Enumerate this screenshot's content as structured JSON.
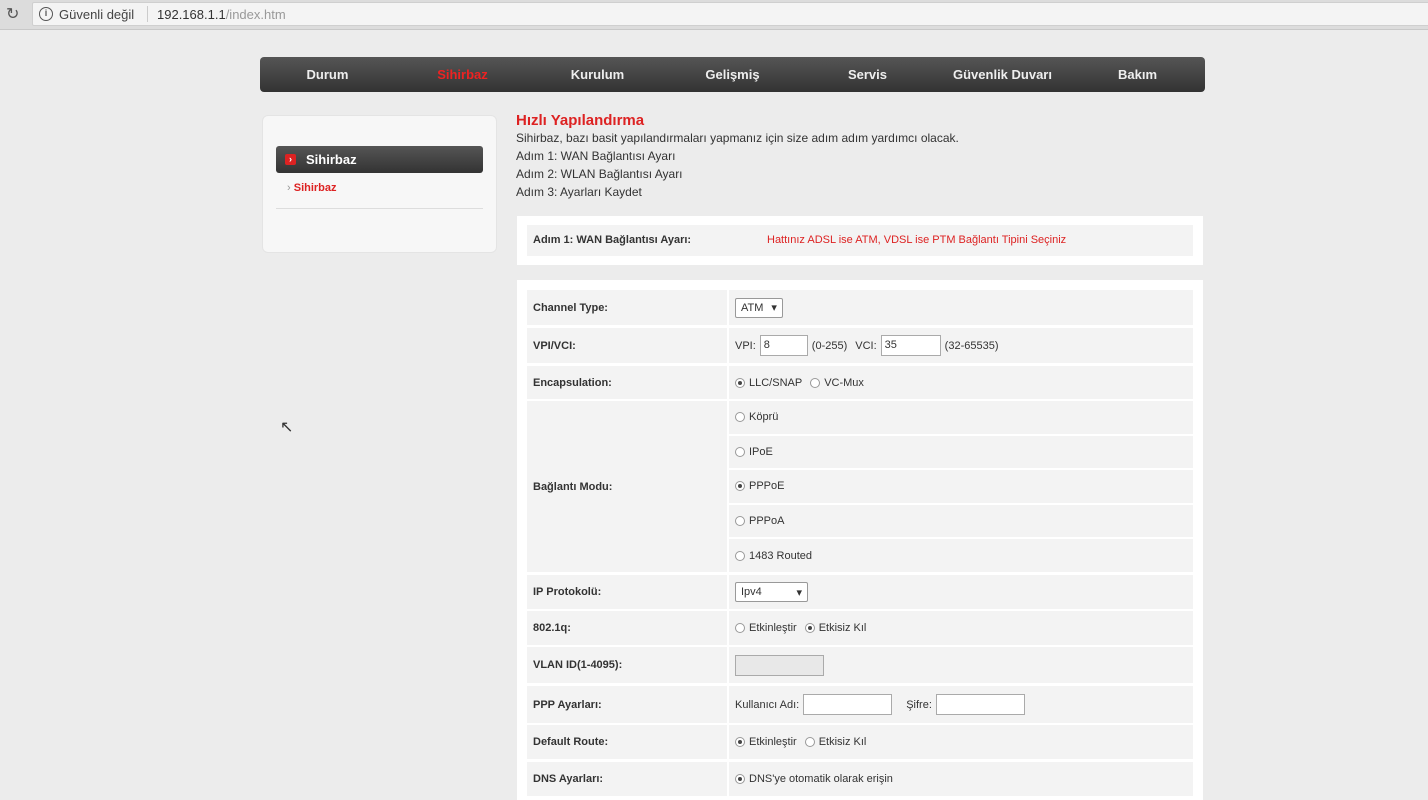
{
  "browser": {
    "security": "Güvenli değil",
    "url_host": "192.168.1.1",
    "url_path": "/index.htm"
  },
  "nav": [
    "Durum",
    "Sihirbaz",
    "Kurulum",
    "Gelişmiş",
    "Servis",
    "Güvenlik Duvarı",
    "Bakım"
  ],
  "sidebar": {
    "header": "Sihirbaz",
    "item": "Sihirbaz"
  },
  "main": {
    "title": "Hızlı Yapılandırma",
    "intro": "Sihirbaz, bazı basit yapılandırmaları yapmanız için size adım adım yardımcı olacak.",
    "steps": [
      "Adım 1: WAN Bağlantısı Ayarı",
      "Adım 2: WLAN Bağlantısı Ayarı",
      "Adım 3: Ayarları Kaydet"
    ]
  },
  "step_box": {
    "label": "Adım 1: WAN Bağlantısı Ayarı:",
    "hint": "Hattınız ADSL ise ATM, VDSL ise PTM Bağlantı Tipini Seçiniz"
  },
  "form": {
    "channel_type": {
      "label": "Channel Type:",
      "value": "ATM"
    },
    "vpivci": {
      "label": "VPI/VCI:",
      "vpi_label": "VPI:",
      "vpi": "8",
      "vpi_range": "(0-255)",
      "vci_label": "VCI:",
      "vci": "35",
      "vci_range": "(32-65535)"
    },
    "encapsulation": {
      "label": "Encapsulation:",
      "options": [
        "LLC/SNAP",
        "VC-Mux"
      ],
      "selected": "LLC/SNAP"
    },
    "mode": {
      "label": "Bağlantı Modu:",
      "options": [
        "Köprü",
        "IPoE",
        "PPPoE",
        "PPPoA",
        "1483 Routed"
      ],
      "selected": "PPPoE"
    },
    "ip": {
      "label": "IP Protokolü:",
      "value": "Ipv4"
    },
    "q8021": {
      "label": "802.1q:",
      "options": [
        "Etkinleştir",
        "Etkisiz Kıl"
      ],
      "selected": "Etkisiz Kıl"
    },
    "vlan": {
      "label": "VLAN ID(1-4095):",
      "value": ""
    },
    "ppp": {
      "label": "PPP Ayarları:",
      "user_label": "Kullanıcı Adı:",
      "pass_label": "Şifre:",
      "user": "",
      "pass": ""
    },
    "default_route": {
      "label": "Default Route:",
      "options": [
        "Etkinleştir",
        "Etkisiz Kıl"
      ],
      "selected": "Etkinleştir"
    },
    "dns": {
      "label": "DNS Ayarları:",
      "option": "DNS'ye otomatik olarak erişin"
    }
  }
}
